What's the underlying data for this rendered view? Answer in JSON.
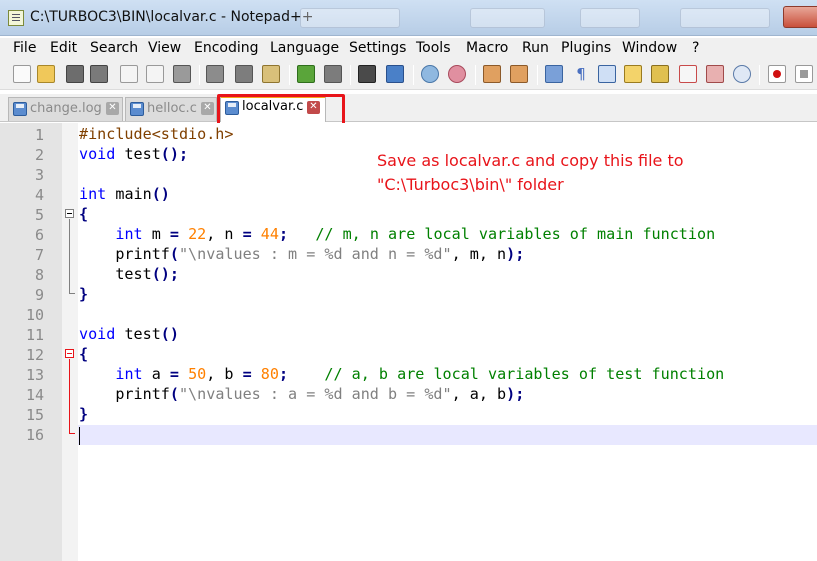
{
  "window": {
    "title": "C:\\TURBOC3\\BIN\\localvar.c - Notepad++"
  },
  "menu": [
    "File",
    "Edit",
    "Search",
    "View",
    "Encoding",
    "Language",
    "Settings",
    "Tools",
    "Macro",
    "Run",
    "Plugins",
    "Window",
    "?"
  ],
  "toolbar_icons": [
    "new-file-icon",
    "open-file-icon",
    "save-icon",
    "save-all-icon",
    "close-icon",
    "close-all-icon",
    "print-icon",
    "cut-icon",
    "copy-icon",
    "paste-icon",
    "undo-icon",
    "redo-icon",
    "find-icon",
    "replace-icon",
    "zoom-in-icon",
    "zoom-out-icon",
    "sync-vertical-icon",
    "sync-horizontal-icon",
    "word-wrap-icon",
    "show-all-characters-icon",
    "indent-guide-icon",
    "user-defined-language-icon",
    "doc-map-icon",
    "function-list-icon",
    "folder-as-workspace-icon",
    "monitoring-icon",
    "record-macro-icon",
    "stop-record-icon"
  ],
  "tabs": [
    {
      "label": "change.log",
      "active": false
    },
    {
      "label": "helloc.c",
      "active": false
    },
    {
      "label": "localvar.c",
      "active": true
    }
  ],
  "tab_close_glyph": "✕",
  "annotation": {
    "line1": "Save as localvar.c and copy this file to",
    "line2": "\"C:\\Turboc3\\bin\\\" folder",
    "color": "#e8141a"
  },
  "code_lines": [
    {
      "n": "1"
    },
    {
      "n": "2"
    },
    {
      "n": "3"
    },
    {
      "n": "4"
    },
    {
      "n": "5"
    },
    {
      "n": "6"
    },
    {
      "n": "7"
    },
    {
      "n": "8"
    },
    {
      "n": "9"
    },
    {
      "n": "10"
    },
    {
      "n": "11"
    },
    {
      "n": "12"
    },
    {
      "n": "13"
    },
    {
      "n": "14"
    },
    {
      "n": "15"
    },
    {
      "n": "16"
    }
  ],
  "code": {
    "l1": "#include<stdio.h>",
    "l2_kw": "void",
    "l2_rest": " test",
    "l2_p": "();",
    "l4_kw": "int",
    "l4_rest": " main",
    "l4_p": "()",
    "brace_open": "{",
    "brace_close": "}",
    "l6_indent": "    ",
    "l6_kw": "int",
    "l6_a": " m ",
    "l6_eq": "=",
    "l6_num1": " 22",
    "l6_b": ", n ",
    "l6_eq2": "=",
    "l6_num2": " 44",
    "l6_semi": ";",
    "l6_comment": "   // m, n are local variables of main function",
    "l7_a": "    printf",
    "l7_p": "(",
    "l7_str": "\"\\nvalues : m = %d and n = %d\"",
    "l7_b": ", m, n",
    "l7_end": ");",
    "l8_a": "    test",
    "l8_end": "();",
    "l11_kw": "void",
    "l11_rest": " test",
    "l11_p": "()",
    "l13_kw": "int",
    "l13_a": " a ",
    "l13_eq": "=",
    "l13_num1": " 50",
    "l13_b": ", b ",
    "l13_eq2": "=",
    "l13_num2": " 80",
    "l13_semi": ";",
    "l13_comment": "    // a, b are local variables of test function",
    "l14_a": "    printf",
    "l14_p": "(",
    "l14_str": "\"\\nvalues : a = %d and b = %d\"",
    "l14_b": ", a, b",
    "l14_end": ");"
  },
  "colors": {
    "keyword": "#0000ff",
    "preprocessor": "#804000",
    "number": "#ff8000",
    "string": "#808080",
    "comment": "#008000",
    "current_line": "#e8e8ff",
    "highlight_box": "#e8141a"
  }
}
